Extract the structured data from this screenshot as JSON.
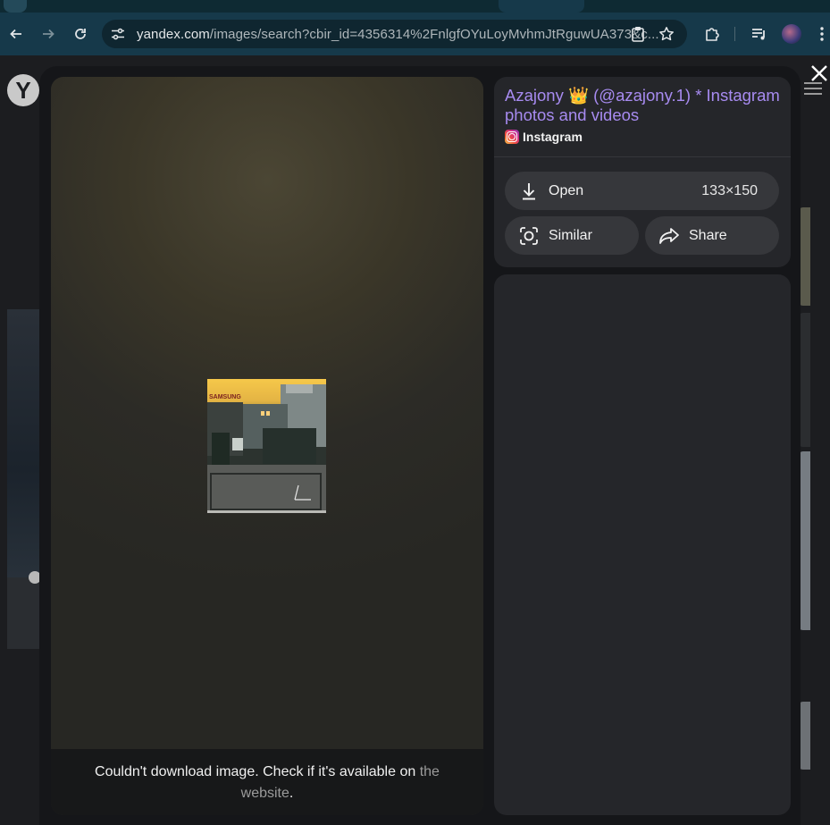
{
  "browser": {
    "url_host": "yandex.com",
    "url_rest": "/images/search?cbir_id=4356314%2FnlgfOYuLoyMvhmJtRguwUA373&c..."
  },
  "page": {
    "logo_letter": "Y"
  },
  "viewer": {
    "error_text": "Couldn't download image. Check if it's available on ",
    "error_link": "the website",
    "error_end": "."
  },
  "info": {
    "title": "Azajony 👑 (@azajony.1) * Instagram photos and videos",
    "source_label": "Instagram",
    "title_color": "#a78bf0"
  },
  "actions": {
    "open_label": "Open",
    "image_size": "133×150",
    "similar_label": "Similar",
    "share_label": "Share"
  },
  "thumbnail": {
    "sign_text": "SAMSUNG"
  }
}
